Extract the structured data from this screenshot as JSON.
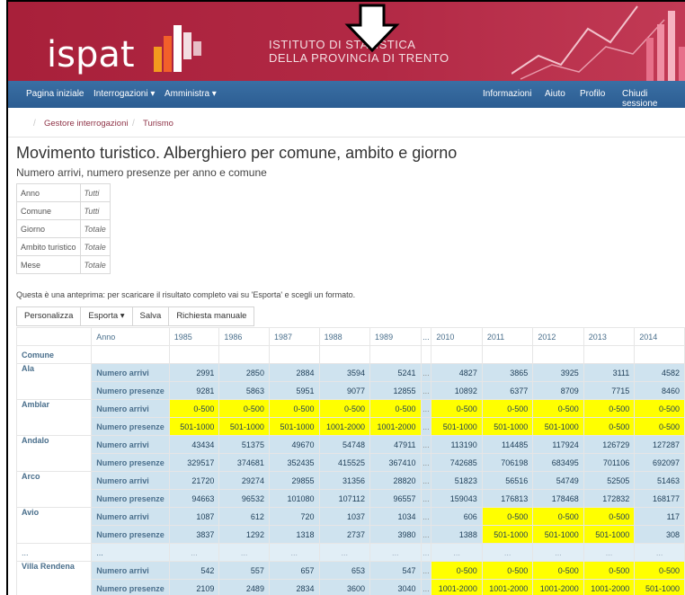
{
  "header": {
    "logo_text": "ispat",
    "institute_line1": "ISTITUTO DI STATISTICA",
    "institute_line2": "DELLA PROVINCIA DI TRENTO"
  },
  "nav": {
    "left": [
      "Pagina iniziale",
      "Interrogazioni ▾",
      "Amministra ▾"
    ],
    "right": [
      "Informazioni",
      "Aiuto",
      "Profilo",
      "Chiudi sessione"
    ]
  },
  "breadcrumb": [
    "Gestore interrogazioni",
    "Turismo"
  ],
  "page": {
    "title": "Movimento turistico. Alberghiero per comune, ambito e giorno",
    "subtitle": "Numero arrivi, numero presenze per anno e comune",
    "note": "Questa è una anteprima: per scaricare il risultato completo vai su 'Esporta' e scegli un formato."
  },
  "filters": [
    {
      "label": "Anno",
      "value": "Tutti"
    },
    {
      "label": "Comune",
      "value": "Tutti"
    },
    {
      "label": "Giorno",
      "value": "Totale"
    },
    {
      "label": "Ambito turistico",
      "value": "Totale"
    },
    {
      "label": "Mese",
      "value": "Totale"
    }
  ],
  "toolbar": [
    "Personalizza",
    "Esporta ▾",
    "Salva",
    "Richiesta manuale"
  ],
  "grid": {
    "corner_label": "Anno",
    "row_header": "Comune",
    "years": [
      "1985",
      "1986",
      "1987",
      "1988",
      "1989",
      "...",
      "2010",
      "2011",
      "2012",
      "2013",
      "2014"
    ],
    "rows": [
      {
        "comune": "Ala",
        "arrivi": [
          "2991",
          "2850",
          "2884",
          "3594",
          "5241",
          "...",
          "4827",
          "3865",
          "3925",
          "3111",
          "4582"
        ],
        "presenze": [
          "9281",
          "5863",
          "5951",
          "9077",
          "12855",
          "...",
          "10892",
          "6377",
          "8709",
          "7715",
          "8460"
        ],
        "hl_arrivi": [],
        "hl_presenze": []
      },
      {
        "comune": "Amblar",
        "arrivi": [
          "0-500",
          "0-500",
          "0-500",
          "0-500",
          "0-500",
          "...",
          "0-500",
          "0-500",
          "0-500",
          "0-500",
          "0-500"
        ],
        "presenze": [
          "501-1000",
          "501-1000",
          "501-1000",
          "1001-2000",
          "1001-2000",
          "...",
          "501-1000",
          "501-1000",
          "501-1000",
          "0-500",
          "0-500"
        ],
        "hl_arrivi": [
          0,
          1,
          2,
          3,
          4,
          6,
          7,
          8,
          9,
          10
        ],
        "hl_presenze": [
          0,
          1,
          2,
          3,
          4,
          6,
          7,
          8,
          9,
          10
        ]
      },
      {
        "comune": "Andalo",
        "arrivi": [
          "43434",
          "51375",
          "49670",
          "54748",
          "47911",
          "...",
          "113190",
          "114485",
          "117924",
          "126729",
          "127287"
        ],
        "presenze": [
          "329517",
          "374681",
          "352435",
          "415525",
          "367410",
          "...",
          "742685",
          "706198",
          "683495",
          "701106",
          "692097"
        ],
        "hl_arrivi": [],
        "hl_presenze": []
      },
      {
        "comune": "Arco",
        "arrivi": [
          "21720",
          "29274",
          "29855",
          "31356",
          "28820",
          "...",
          "51823",
          "56516",
          "54749",
          "52505",
          "51463"
        ],
        "presenze": [
          "94663",
          "96532",
          "101080",
          "107112",
          "96557",
          "...",
          "159043",
          "176813",
          "178468",
          "172832",
          "168177"
        ],
        "hl_arrivi": [],
        "hl_presenze": []
      },
      {
        "comune": "Avio",
        "arrivi": [
          "1087",
          "612",
          "720",
          "1037",
          "1034",
          "...",
          "606",
          "0-500",
          "0-500",
          "0-500",
          "117"
        ],
        "presenze": [
          "3837",
          "1292",
          "1318",
          "2737",
          "3980",
          "...",
          "1388",
          "501-1000",
          "501-1000",
          "501-1000",
          "308"
        ],
        "hl_arrivi": [
          7,
          8,
          9
        ],
        "hl_presenze": [
          7,
          8,
          9
        ]
      },
      {
        "comune": "Villa Rendena",
        "arrivi": [
          "542",
          "557",
          "657",
          "653",
          "547",
          "...",
          "0-500",
          "0-500",
          "0-500",
          "0-500",
          "0-500"
        ],
        "presenze": [
          "2109",
          "2489",
          "2834",
          "3600",
          "3040",
          "...",
          "1001-2000",
          "1001-2000",
          "1001-2000",
          "1001-2000",
          "501-1000"
        ],
        "hl_arrivi": [
          6,
          7,
          8,
          9,
          10
        ],
        "hl_presenze": [
          6,
          7,
          8,
          9,
          10
        ]
      }
    ],
    "measure_arrivi": "Numero arrivi",
    "measure_presenze": "Numero presenze",
    "ellipsis": "..."
  },
  "colors": {
    "banner": "#b22945",
    "nav": "#2c5d92",
    "highlight": "#ffff00",
    "cell": "#cfe3ef"
  }
}
